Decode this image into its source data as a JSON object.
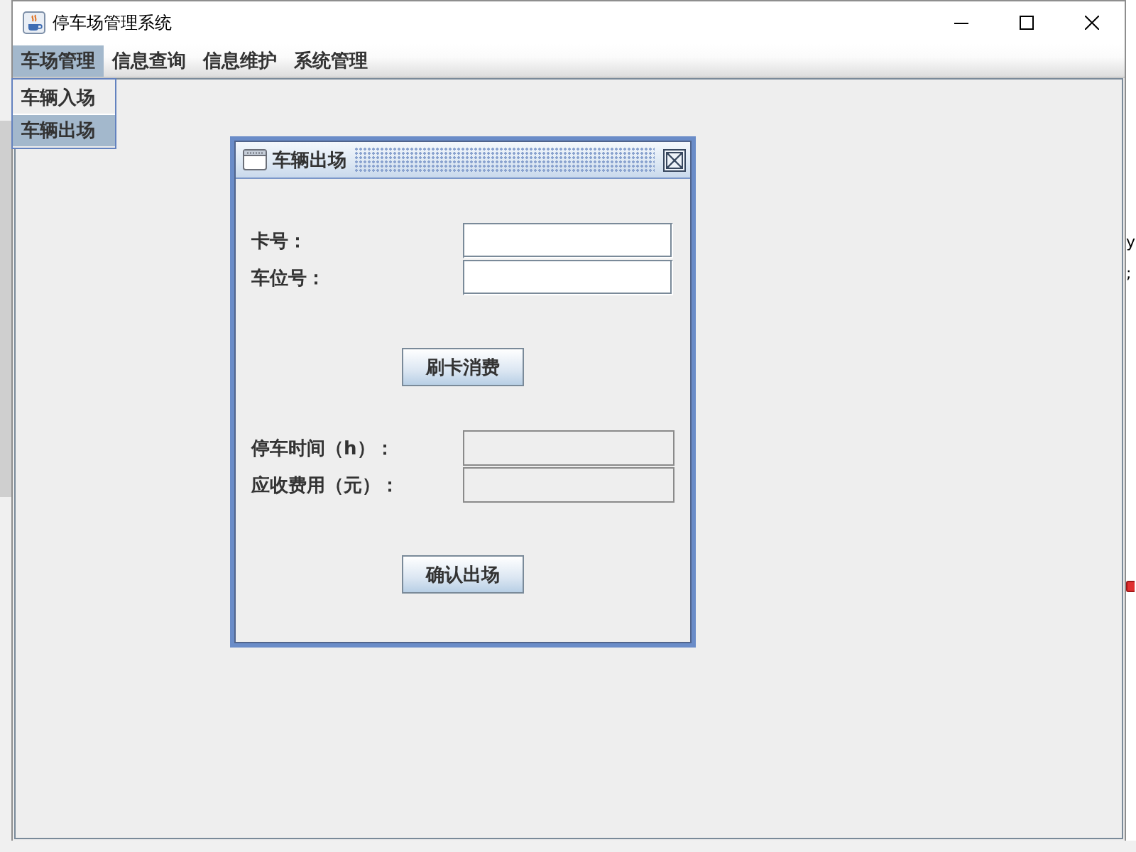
{
  "window": {
    "title": "停车场管理系统"
  },
  "menu_bar": {
    "menus": [
      {
        "label": "车场管理",
        "selected": true
      },
      {
        "label": "信息查询",
        "selected": false
      },
      {
        "label": "信息维护",
        "selected": false
      },
      {
        "label": "系统管理",
        "selected": false
      }
    ]
  },
  "open_menu": {
    "items": [
      {
        "label": "车辆入场",
        "selected": false
      },
      {
        "label": "车辆出场",
        "selected": true
      }
    ]
  },
  "internal_frame": {
    "title": "车辆出场",
    "sections": [
      {
        "fields": [
          {
            "label": "卡号：",
            "disabled": false
          },
          {
            "label": "车位号：",
            "disabled": false
          }
        ],
        "button": "刷卡消费"
      },
      {
        "fields": [
          {
            "label": "停车时间（h）：",
            "disabled": true
          },
          {
            "label": "应收费用（元）：",
            "disabled": true
          }
        ],
        "button": "确认出场"
      }
    ]
  },
  "background_window": {
    "text_fragments": [
      "y",
      ";"
    ]
  }
}
